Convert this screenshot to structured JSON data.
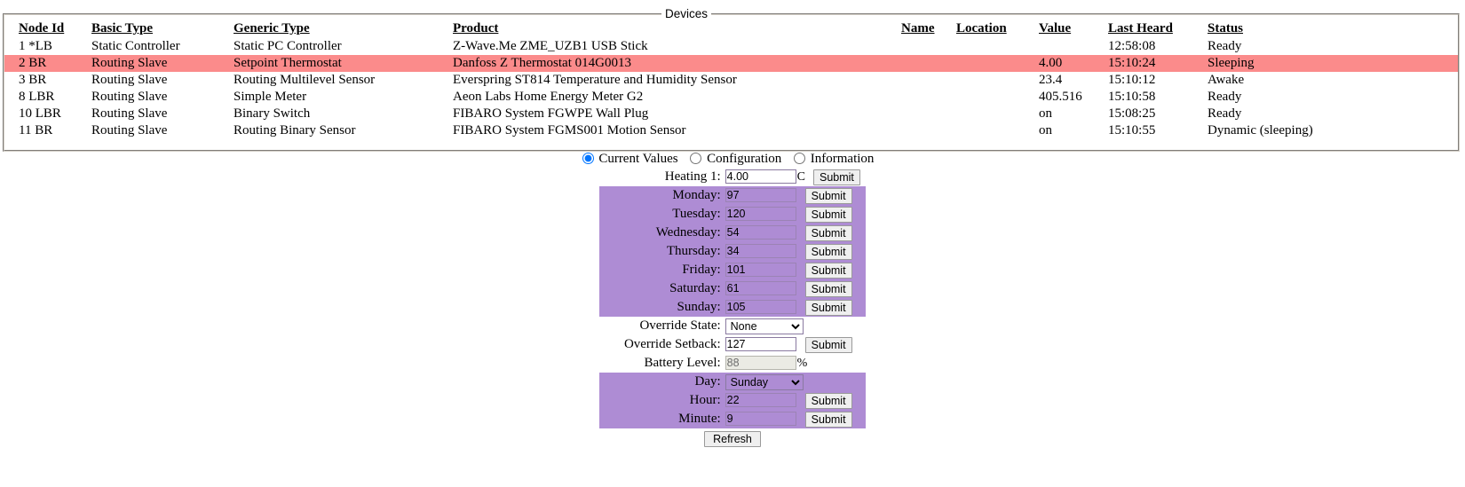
{
  "devices_panel": {
    "legend": "Devices",
    "columns": [
      "Node Id",
      "Basic Type",
      "Generic Type",
      "Product",
      "Name",
      "Location",
      "Value",
      "Last Heard",
      "Status"
    ],
    "rows": [
      {
        "node_id": "1 *LB",
        "basic_type": "Static Controller",
        "generic_type": "Static PC Controller",
        "product": "Z-Wave.Me ZME_UZB1 USB Stick",
        "name": "",
        "location": "",
        "value": "",
        "last_heard": "12:58:08",
        "status": "Ready",
        "selected": false
      },
      {
        "node_id": "2 BR",
        "basic_type": "Routing Slave",
        "generic_type": "Setpoint Thermostat",
        "product": "Danfoss Z Thermostat 014G0013",
        "name": "",
        "location": "",
        "value": "4.00",
        "last_heard": "15:10:24",
        "status": "Sleeping",
        "selected": true
      },
      {
        "node_id": "3 BR",
        "basic_type": "Routing Slave",
        "generic_type": "Routing Multilevel Sensor",
        "product": "Everspring ST814 Temperature and Humidity Sensor",
        "name": "",
        "location": "",
        "value": "23.4",
        "last_heard": "15:10:12",
        "status": "Awake",
        "selected": false
      },
      {
        "node_id": "8 LBR",
        "basic_type": "Routing Slave",
        "generic_type": "Simple Meter",
        "product": "Aeon Labs Home Energy Meter G2",
        "name": "",
        "location": "",
        "value": "405.516",
        "last_heard": "15:10:58",
        "status": "Ready",
        "selected": false
      },
      {
        "node_id": "10 LBR",
        "basic_type": "Routing Slave",
        "generic_type": "Binary Switch",
        "product": "FIBARO System FGWPE Wall Plug",
        "name": "",
        "location": "",
        "value": "on",
        "last_heard": "15:08:25",
        "status": "Ready",
        "selected": false
      },
      {
        "node_id": "11 BR",
        "basic_type": "Routing Slave",
        "generic_type": "Routing Binary Sensor",
        "product": "FIBARO System FGMS001 Motion Sensor",
        "name": "",
        "location": "",
        "value": "on",
        "last_heard": "15:10:55",
        "status": "Dynamic (sleeping)",
        "selected": false
      }
    ],
    "highlight_color": "#fb8b8b"
  },
  "detail_panel": {
    "view_modes": [
      {
        "label": "Current Values",
        "selected": true
      },
      {
        "label": "Configuration",
        "selected": false
      },
      {
        "label": "Information",
        "selected": false
      }
    ],
    "purple_color": "#ae8cd4",
    "submit_label": "Submit",
    "refresh_label": "Refresh",
    "fields": [
      {
        "label": "Heating 1:",
        "value": "4.00",
        "suffix": "C",
        "type": "text",
        "submit": true,
        "purple": false,
        "readonly": false
      },
      {
        "label": "Monday:",
        "value": "97",
        "suffix": "",
        "type": "text",
        "submit": true,
        "purple": true,
        "readonly": false
      },
      {
        "label": "Tuesday:",
        "value": "120",
        "suffix": "",
        "type": "text",
        "submit": true,
        "purple": true,
        "readonly": false
      },
      {
        "label": "Wednesday:",
        "value": "54",
        "suffix": "",
        "type": "text",
        "submit": true,
        "purple": true,
        "readonly": false
      },
      {
        "label": "Thursday:",
        "value": "34",
        "suffix": "",
        "type": "text",
        "submit": true,
        "purple": true,
        "readonly": false
      },
      {
        "label": "Friday:",
        "value": "101",
        "suffix": "",
        "type": "text",
        "submit": true,
        "purple": true,
        "readonly": false
      },
      {
        "label": "Saturday:",
        "value": "61",
        "suffix": "",
        "type": "text",
        "submit": true,
        "purple": true,
        "readonly": false
      },
      {
        "label": "Sunday:",
        "value": "105",
        "suffix": "",
        "type": "text",
        "submit": true,
        "purple": true,
        "readonly": false
      },
      {
        "label": "Override State:",
        "value": "None",
        "suffix": "",
        "type": "select",
        "submit": false,
        "purple": false,
        "readonly": false
      },
      {
        "label": "Override Setback:",
        "value": "127",
        "suffix": "",
        "type": "text",
        "submit": true,
        "purple": false,
        "readonly": false
      },
      {
        "label": "Battery Level:",
        "value": "88",
        "suffix": "%",
        "type": "text",
        "submit": false,
        "purple": false,
        "readonly": true
      },
      {
        "label": "Day:",
        "value": "Sunday",
        "suffix": "",
        "type": "select",
        "submit": false,
        "purple": true,
        "readonly": false
      },
      {
        "label": "Hour:",
        "value": "22",
        "suffix": "",
        "type": "text",
        "submit": true,
        "purple": true,
        "readonly": false
      },
      {
        "label": "Minute:",
        "value": "9",
        "suffix": "",
        "type": "text",
        "submit": true,
        "purple": true,
        "readonly": false
      }
    ]
  }
}
